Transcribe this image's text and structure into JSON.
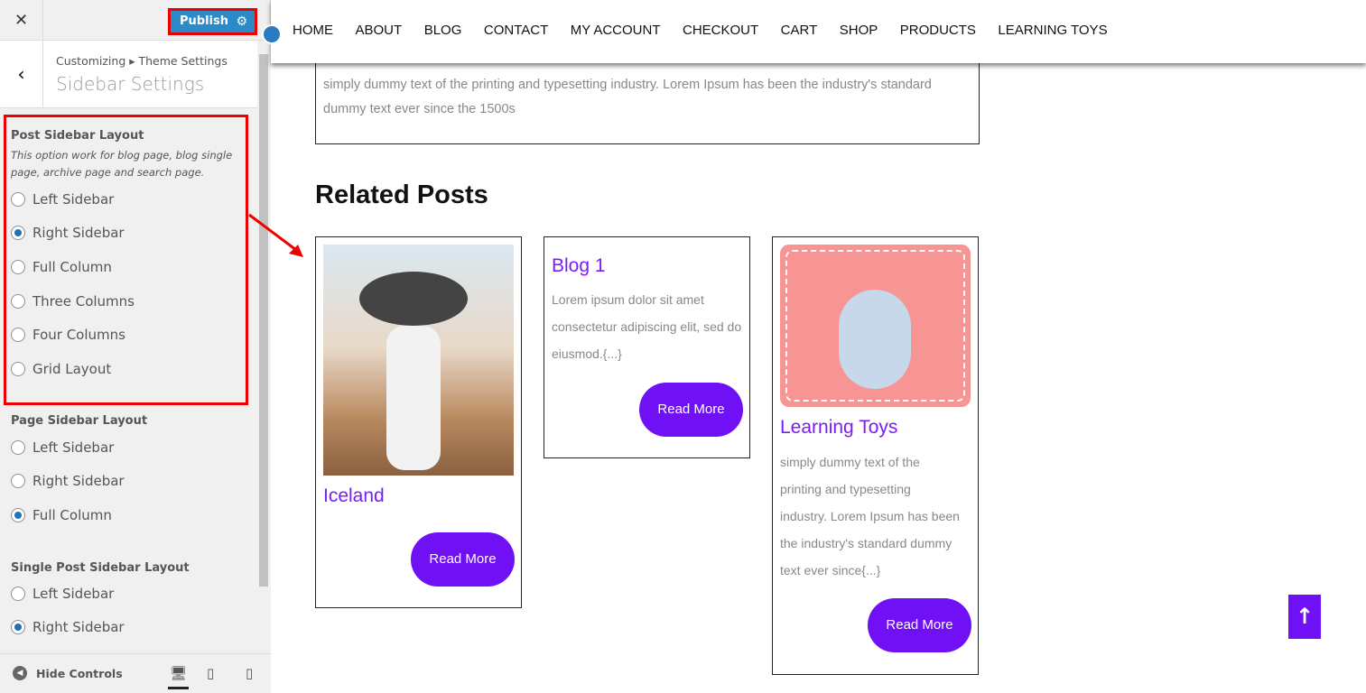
{
  "panel": {
    "close": "✕",
    "publish": "Publish",
    "breadcrumb": "Customizing ▸ Theme Settings",
    "title": "Sidebar Settings",
    "post": {
      "label": "Post Sidebar Layout",
      "desc": "This option work for blog page, blog single page, archive page and search page.",
      "options": [
        "Left Sidebar",
        "Right Sidebar",
        "Full Column",
        "Three Columns",
        "Four Columns",
        "Grid Layout"
      ],
      "selected": "Right Sidebar"
    },
    "page": {
      "label": "Page Sidebar Layout",
      "options": [
        "Left Sidebar",
        "Right Sidebar",
        "Full Column"
      ],
      "selected": "Full Column"
    },
    "single": {
      "label": "Single Post Sidebar Layout",
      "options": [
        "Left Sidebar",
        "Right Sidebar"
      ],
      "selected": "Right Sidebar"
    },
    "hide_controls": "Hide Controls"
  },
  "nav": {
    "items": [
      "HOME",
      "ABOUT",
      "BLOG",
      "CONTACT",
      "MY ACCOUNT",
      "CHECKOUT",
      "CART",
      "SHOP",
      "PRODUCTS",
      "LEARNING TOYS"
    ]
  },
  "content": {
    "top_text": " simply dummy text of the printing and typesetting industry. Lorem Ipsum has been the industry's standard dummy text ever since the 1500s",
    "related": "Related Posts",
    "cards": [
      {
        "title": "Iceland",
        "read": "Read More"
      },
      {
        "title": "Blog 1",
        "text": "Lorem ipsum dolor sit amet consectetur adipiscing elit, sed do eiusmod.{...}",
        "read": "Read More"
      },
      {
        "title": "Learning Toys",
        "text": " simply dummy text of the printing and typesetting industry. Lorem Ipsum has been the industry's standard dummy text ever since{...}",
        "read": "Read More"
      }
    ]
  },
  "colors": {
    "accent": "#7010f5",
    "publish": "#2a8bc8",
    "highlight": "#e00000"
  }
}
